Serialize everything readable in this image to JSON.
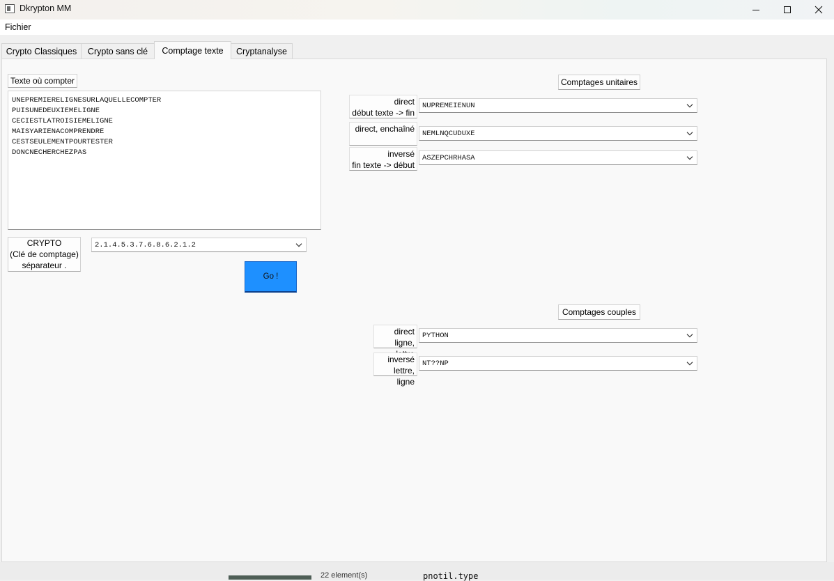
{
  "window": {
    "title": "Dkrypton MM"
  },
  "menu": {
    "fichier": "Fichier"
  },
  "tabs": [
    {
      "label": "Crypto Classiques",
      "active": false
    },
    {
      "label": "Crypto sans clé",
      "active": false
    },
    {
      "label": "Comptage texte",
      "active": true
    },
    {
      "label": "Cryptanalyse",
      "active": false
    }
  ],
  "left": {
    "text_label": "Texte où compter",
    "text_value": "UNEPREMIERELIGNESURLAQUELLECOMPTER\nPUISUNEDEUXIEMELIGNE\nCECIESTLATROISIEMELIGNE\nMAISYARIENACOMPRENDRE\nCESTSEULEMENTPOURTESTER\nDONCNECHERCHEZPAS",
    "crypto_label_1": "CRYPTO",
    "crypto_label_2": "(Clé de comptage)",
    "crypto_label_3": "séparateur .",
    "crypto_value": "2.1.4.5.3.7.6.8.6.2.1.2",
    "go_label": "Go !"
  },
  "unitaires": {
    "header": "Comptages unitaires",
    "direct_label_1": "direct",
    "direct_label_2": "début texte -> fin",
    "direct_value": "NUPREMEIENUN",
    "enchaine_label": "direct, enchaîné",
    "enchaine_value": "NEMLNQCUDUXE",
    "inverse_label_1": "inversé",
    "inverse_label_2": "fin texte -> début",
    "inverse_value": "ASZEPCHRHASA"
  },
  "couples": {
    "header": "Comptages couples",
    "direct_label_1": "direct",
    "direct_label_2": "ligne, lettre",
    "direct_value": "PYTHON",
    "inverse_label_1": "inversé",
    "inverse_label_2": "lettre, ligne",
    "inverse_value": "NT??NP"
  },
  "background_window": {
    "text1": "22 element(s)",
    "text2": "pnotil.type"
  }
}
